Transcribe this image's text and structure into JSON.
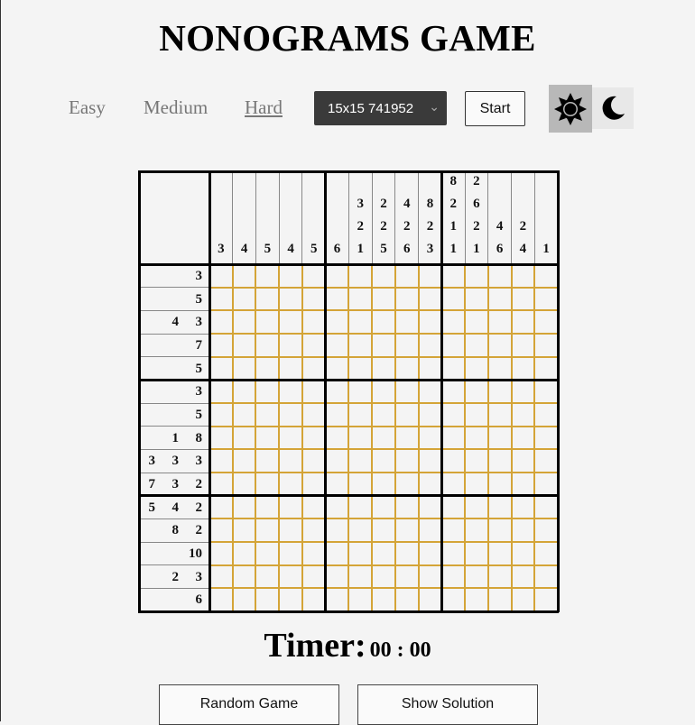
{
  "title": "NONOGRAMS GAME",
  "difficulty": {
    "items": [
      "Easy",
      "Medium",
      "Hard"
    ],
    "active": "Hard"
  },
  "puzzle_select": {
    "value": "15x15 741952"
  },
  "start_label": "Start",
  "theme": {
    "light_icon": "sun-icon",
    "dark_icon": "moon-icon",
    "active": "light"
  },
  "grid": {
    "size": 15,
    "column_clues": [
      [
        "3"
      ],
      [
        "4"
      ],
      [
        "5"
      ],
      [
        "4"
      ],
      [
        "5"
      ],
      [
        "6"
      ],
      [
        "3",
        "2",
        "1"
      ],
      [
        "2",
        "2",
        "5"
      ],
      [
        "4",
        "2",
        "6"
      ],
      [
        "8",
        "2",
        "3"
      ],
      [
        "8",
        "2",
        "1",
        "1"
      ],
      [
        "2",
        "6",
        "2",
        "1"
      ],
      [
        "4",
        "6"
      ],
      [
        "2",
        "4"
      ],
      [
        "1"
      ]
    ],
    "row_clues": [
      [
        "3"
      ],
      [
        "5"
      ],
      [
        "4",
        "3"
      ],
      [
        "7"
      ],
      [
        "5"
      ],
      [
        "3"
      ],
      [
        "5"
      ],
      [
        "1",
        "8"
      ],
      [
        "3",
        "3",
        "3"
      ],
      [
        "7",
        "3",
        "2"
      ],
      [
        "5",
        "4",
        "2"
      ],
      [
        "8",
        "2"
      ],
      [
        "10"
      ],
      [
        "2",
        "3"
      ],
      [
        "6"
      ]
    ],
    "colors": {
      "cell_line": "#d4a437",
      "block_line": "#000000",
      "background": "#f4f4f4"
    }
  },
  "timer": {
    "label": "Timer:",
    "value": "00 : 00"
  },
  "buttons": {
    "random": "Random Game",
    "solution": "Show Solution"
  }
}
